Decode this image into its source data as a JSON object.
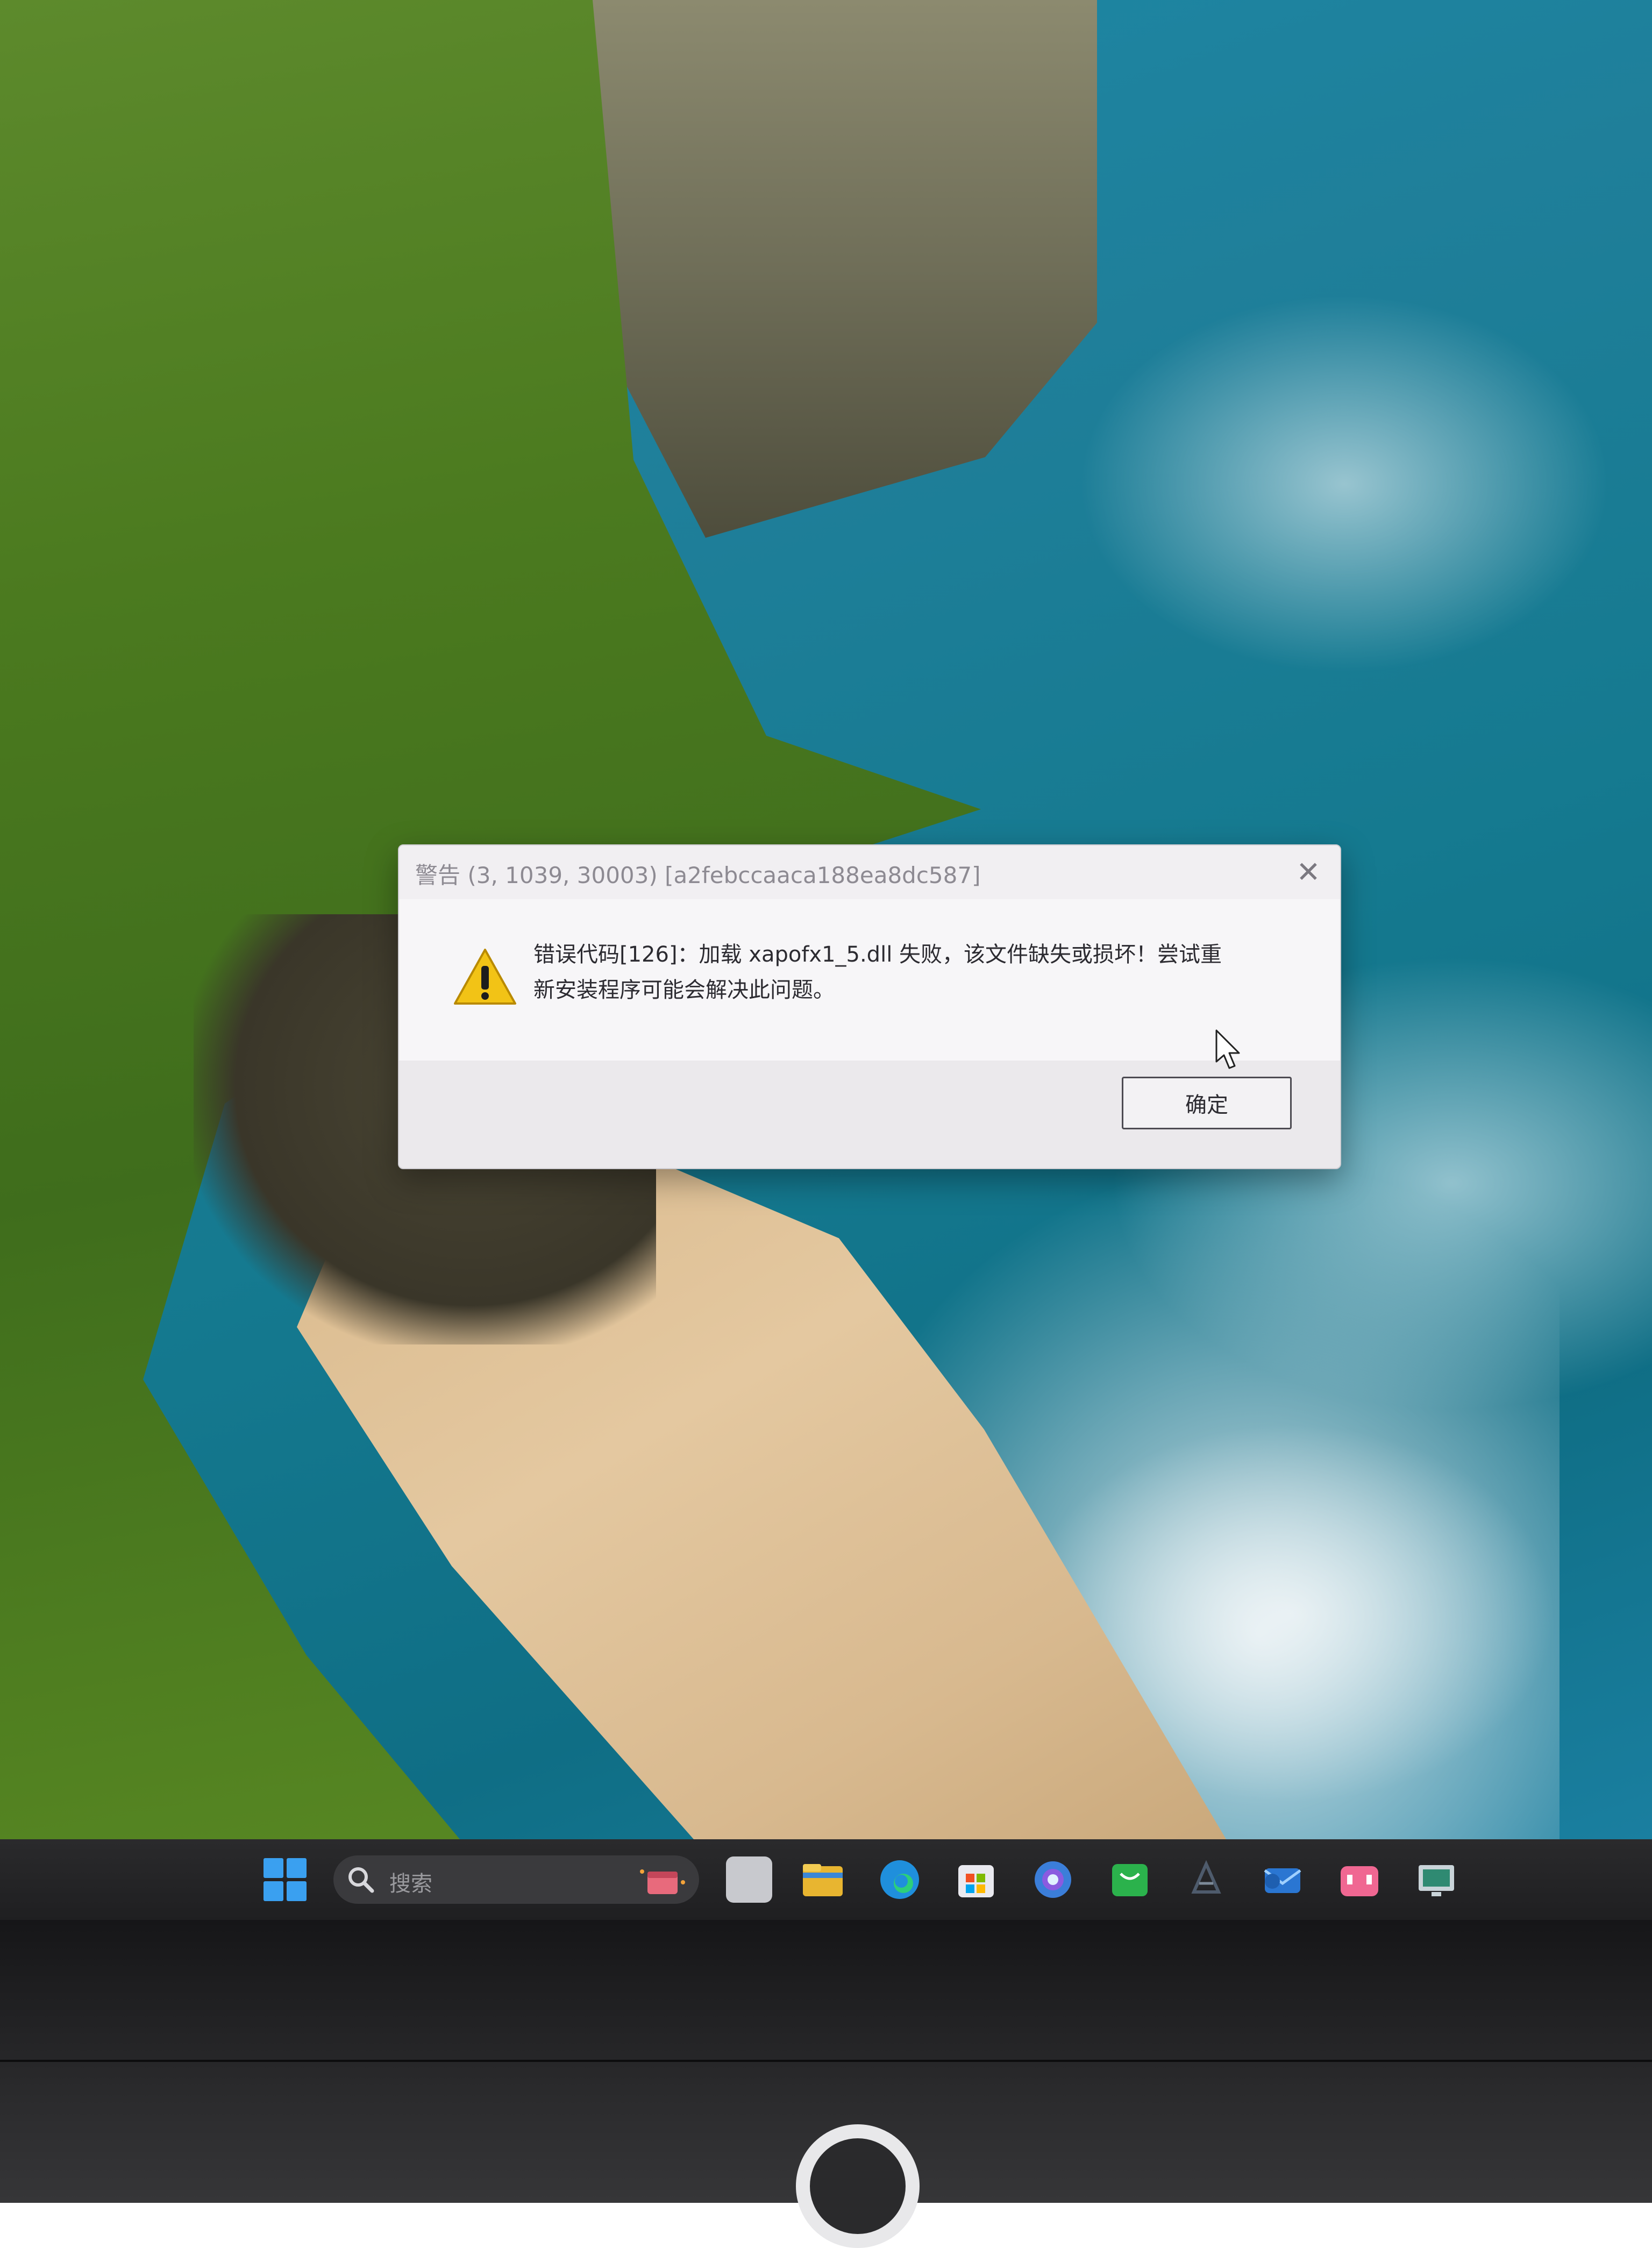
{
  "dialog": {
    "title": "警告 (3, 1039, 30003) [a2febccaaca188ea8dc587]",
    "message_line1": "错误代码[126]：加载 xapofx1_5.dll 失败，该文件缺失或损坏！尝试重",
    "message_line2": "新安装程序可能会解决此问题。",
    "ok_label": "确定",
    "close_glyph": "✕"
  },
  "taskbar": {
    "search_placeholder": "搜索",
    "apps": [
      {
        "icon": "file-explorer-icon",
        "color": "#e8b530"
      },
      {
        "icon": "edge-browser-icon",
        "color": "#1f8fdc"
      },
      {
        "icon": "microsoft-store-icon",
        "color": "#e9e9ef"
      },
      {
        "icon": "copilot-icon",
        "color": "#3b7ed9"
      },
      {
        "icon": "wechat-icon",
        "color": "#2bb24c"
      },
      {
        "icon": "steam-icon",
        "color": "#2a3f5a"
      },
      {
        "icon": "mail-icon",
        "color": "#2a76d2"
      },
      {
        "icon": "bilibili-icon",
        "color": "#f06792"
      },
      {
        "icon": "remote-desktop-icon",
        "color": "#c9d4d9"
      }
    ]
  },
  "colors": {
    "accent_start": "#3aa0f0",
    "warning_yellow": "#f2c316"
  }
}
